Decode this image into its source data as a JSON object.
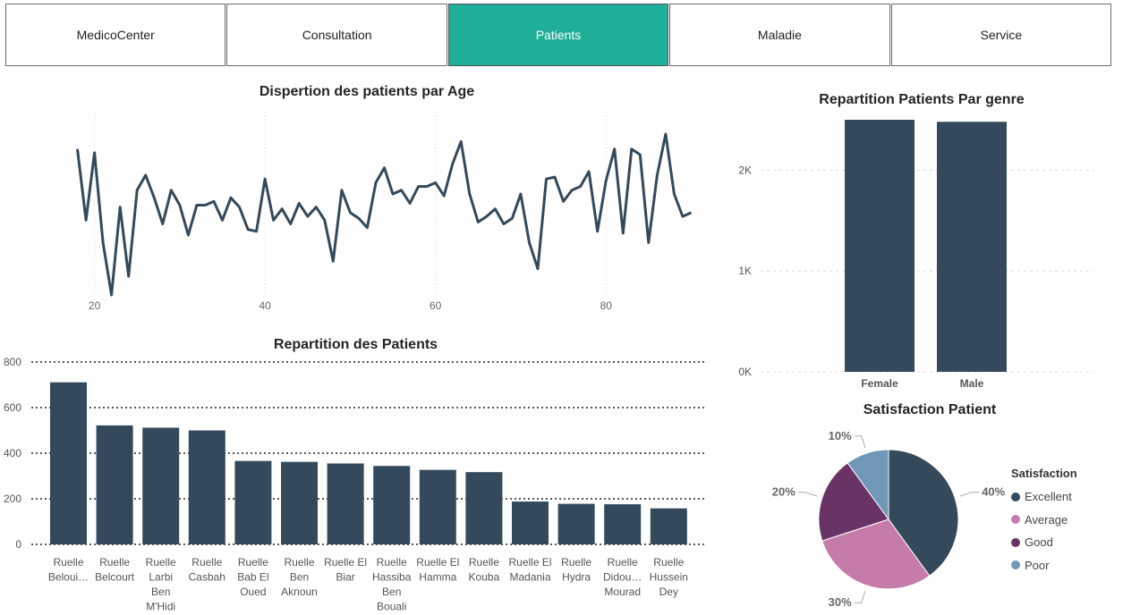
{
  "nav": {
    "items": [
      {
        "label": "MedicoCenter",
        "active": false
      },
      {
        "label": "Consultation",
        "active": false
      },
      {
        "label": "Patients",
        "active": true
      },
      {
        "label": "Maladie",
        "active": false
      },
      {
        "label": "Service",
        "active": false
      }
    ]
  },
  "age_chart": {
    "title": "Dispertion des patients par Age"
  },
  "repartition_chart": {
    "title": "Repartition des Patients"
  },
  "genre_chart": {
    "title": "Repartition Patients Par genre"
  },
  "satisfaction_chart": {
    "title": "Satisfaction Patient",
    "legend_title": "Satisfaction"
  },
  "colors": {
    "accent": "#1fae98",
    "bar": "#344a5c",
    "line": "#34495a",
    "excellent": "#34495a",
    "average": "#c57ca9",
    "good": "#6a3366",
    "poor": "#7096b8"
  },
  "chart_data": [
    {
      "type": "line",
      "title": "Dispertion des patients par Age",
      "xlabel": "",
      "ylabel": "",
      "x": [
        18,
        19,
        20,
        21,
        22,
        23,
        24,
        25,
        26,
        27,
        28,
        29,
        30,
        31,
        32,
        33,
        34,
        35,
        36,
        37,
        38,
        39,
        40,
        41,
        42,
        43,
        44,
        45,
        46,
        47,
        48,
        49,
        50,
        51,
        52,
        53,
        54,
        55,
        56,
        57,
        58,
        59,
        60,
        61,
        62,
        63,
        64,
        65,
        66,
        67,
        68,
        69,
        70,
        71,
        72,
        73,
        74,
        75,
        76,
        77,
        78,
        79,
        80,
        81,
        82,
        83,
        84,
        85,
        86,
        87,
        88,
        89,
        90
      ],
      "y": [
        58,
        20,
        56,
        8,
        -20,
        27,
        -10,
        36,
        44,
        32,
        18,
        36,
        28,
        12,
        28,
        28,
        30,
        20,
        32,
        27,
        15,
        14,
        42,
        20,
        26,
        18,
        29,
        22,
        27,
        20,
        -2,
        36,
        24,
        21,
        16,
        40,
        48,
        34,
        36,
        29,
        38,
        38,
        40,
        33,
        50,
        62,
        34,
        19,
        22,
        26,
        18,
        21,
        34,
        8,
        -6,
        42,
        43,
        30,
        36,
        38,
        46,
        14,
        41,
        58,
        13,
        58,
        55,
        8,
        44,
        66,
        34,
        22,
        24
      ],
      "xticks": [
        20,
        40,
        60,
        80
      ],
      "xlim": [
        17,
        91
      ],
      "ylim": [
        -20,
        66
      ],
      "grid": false
    },
    {
      "type": "bar",
      "title": "Repartition des Patients",
      "categories": [
        "Ruelle Beloui…",
        "Ruelle Belcourt",
        "Ruelle Larbi Ben M'Hidi",
        "Ruelle Casbah",
        "Ruelle Bab El Oued",
        "Ruelle Ben Aknoun",
        "Ruelle El Biar",
        "Ruelle Hassiba Ben Bouali",
        "Ruelle El Hamma",
        "Ruelle Kouba",
        "Ruelle El Madania",
        "Ruelle Hydra",
        "Ruelle Didou… Mourad",
        "Ruelle Hussein Dey"
      ],
      "category_lines": [
        [
          "Ruelle",
          "Beloui…"
        ],
        [
          "Ruelle",
          "Belcourt"
        ],
        [
          "Ruelle",
          "Larbi",
          "Ben",
          "M'Hidi"
        ],
        [
          "Ruelle",
          "Casbah"
        ],
        [
          "Ruelle",
          "Bab El",
          "Oued"
        ],
        [
          "Ruelle",
          "Ben",
          "Aknoun"
        ],
        [
          "Ruelle El",
          "Biar"
        ],
        [
          "Ruelle",
          "Hassiba",
          "Ben",
          "Bouali"
        ],
        [
          "Ruelle El",
          "Hamma"
        ],
        [
          "Ruelle",
          "Kouba"
        ],
        [
          "Ruelle El",
          "Madania"
        ],
        [
          "Ruelle",
          "Hydra"
        ],
        [
          "Ruelle",
          "Didou…",
          "Mourad"
        ],
        [
          "Ruelle",
          "Hussein",
          "Dey"
        ]
      ],
      "values": [
        711,
        522,
        512,
        500,
        366,
        362,
        355,
        344,
        327,
        317,
        188,
        178,
        176,
        158
      ],
      "yticks": [
        0,
        200,
        400,
        600,
        800
      ],
      "ylim": [
        0,
        800
      ],
      "grid": true
    },
    {
      "type": "bar",
      "title": "Repartition Patients Par genre",
      "categories": [
        "Female",
        "Male"
      ],
      "values": [
        2500,
        2480
      ],
      "yticks": [
        0,
        1000,
        2000
      ],
      "ytick_labels": [
        "0K",
        "1K",
        "2K"
      ],
      "ylim": [
        0,
        2500
      ],
      "grid": true
    },
    {
      "type": "pie",
      "title": "Satisfaction Patient",
      "labels": [
        "Excellent",
        "Average",
        "Good",
        "Poor"
      ],
      "values": [
        40,
        30,
        20,
        10
      ],
      "value_labels": [
        "40%",
        "30%",
        "20%",
        "10%"
      ],
      "legend_title": "Satisfaction",
      "legend": "right"
    }
  ]
}
